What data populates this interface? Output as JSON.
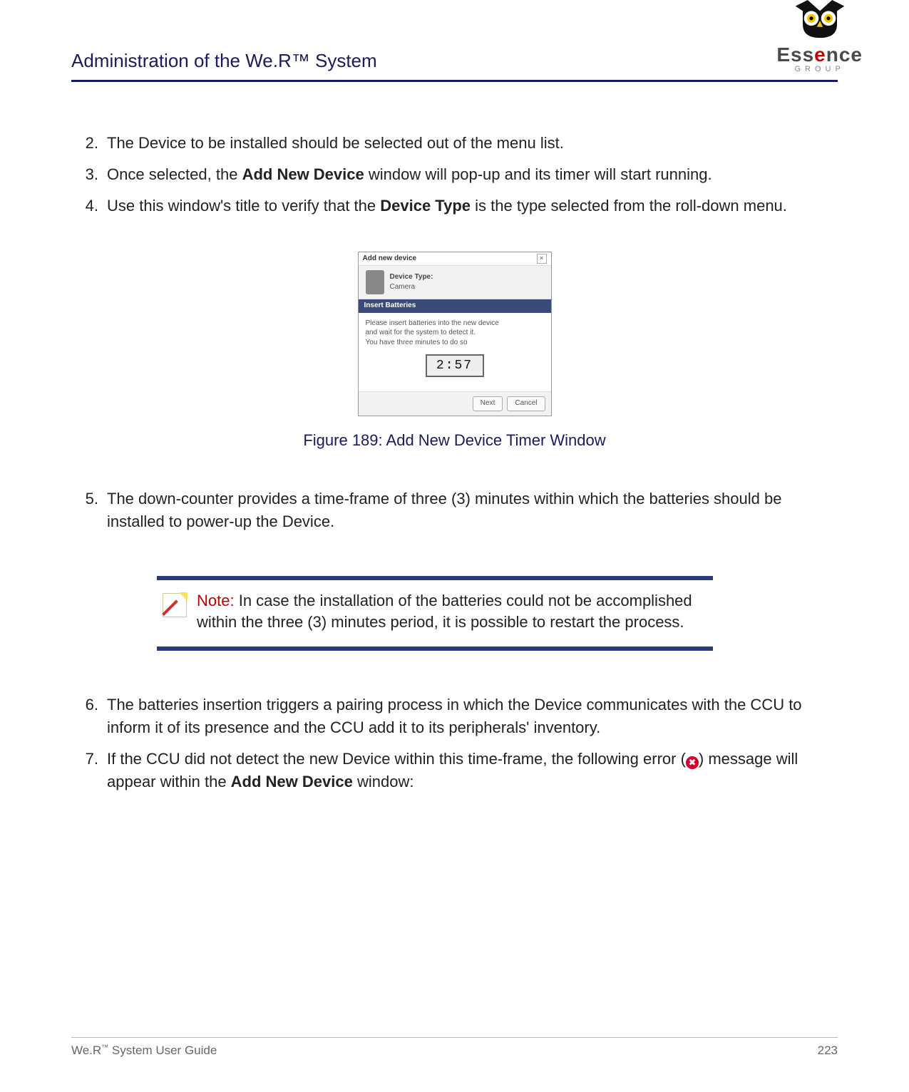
{
  "header": {
    "title": "Administration of the We.R™ System",
    "logo_word_plain": "Ess",
    "logo_word_red": "e",
    "logo_word_rest": "nce",
    "logo_group": "GROUP"
  },
  "steps_a": [
    {
      "n": "2.",
      "text": "The Device to be installed should be selected out of the menu list."
    },
    {
      "n": "3.",
      "pre": "Once selected, the ",
      "b1": "Add New Device",
      "post": " window will pop-up and its timer will start running."
    },
    {
      "n": "4.",
      "pre": "Use this window's title to verify that the ",
      "b1": "Device Type",
      "post": " is the type selected from the roll-down menu."
    }
  ],
  "figure": {
    "dialog_title": "Add new device",
    "device_type_label": "Device Type:",
    "device_type_value": "Camera",
    "section_title": "Insert Batteries",
    "body_line1": "Please insert batteries into the new device",
    "body_line2": "and wait for the system to detect it.",
    "body_line3": "You have three minutes to do so",
    "timer": "2:57",
    "btn_next": "Next",
    "btn_cancel": "Cancel",
    "caption": "Figure 189: Add New Device Timer Window"
  },
  "steps_b": [
    {
      "n": "5.",
      "text": "The down-counter provides a time-frame of three (3) minutes within which the batteries should be installed to power-up the Device."
    }
  ],
  "note": {
    "label": "Note:",
    "text": " In case the installation of the batteries could not be accomplished within the three (3) minutes period, it is possible to restart the process."
  },
  "steps_c": [
    {
      "n": "6.",
      "text": "The batteries insertion triggers a pairing process in which the Device communicates with the CCU to inform it of its presence and the CCU add it to its peripherals' inventory."
    },
    {
      "n": "7.",
      "pre": "If the CCU did not detect the new Device within this time-frame, the following error (",
      "post_pre": ") message will appear within the ",
      "b1": "Add New Device",
      "post": " window:"
    }
  ],
  "footer": {
    "left_pre": "We.R",
    "left_sup": "™",
    "left_post": " System User Guide",
    "page": "223"
  },
  "icons": {
    "close_x": "×",
    "error_x": "✖"
  }
}
